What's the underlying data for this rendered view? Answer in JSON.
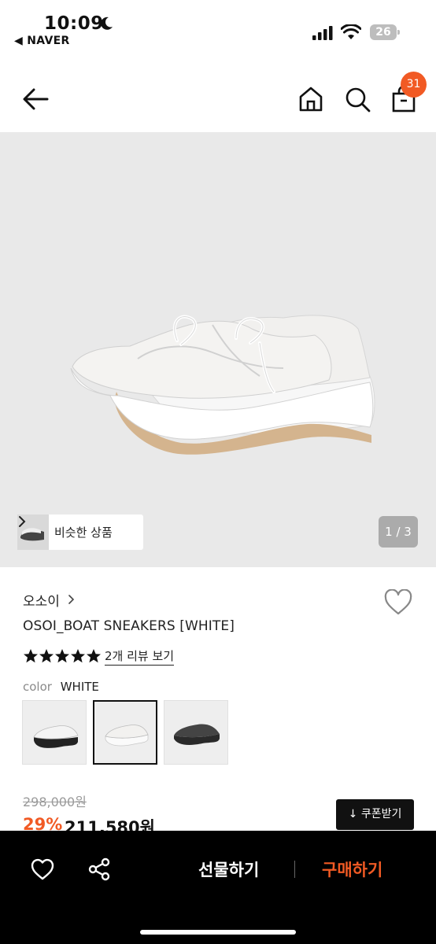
{
  "status_bar": {
    "time": "10:09",
    "back_app": "◀ NAVER",
    "battery": "26",
    "icons": [
      "moon-icon",
      "signal-icon",
      "wifi-icon",
      "battery-icon"
    ]
  },
  "nav": {
    "icons": [
      "back-arrow-icon",
      "home-icon",
      "search-icon",
      "cart-icon"
    ],
    "cart_badge": "31"
  },
  "hero": {
    "similar_label": "비슷한 상품",
    "pager": "1 / 3"
  },
  "product": {
    "brand": "오소이",
    "title": "OSOI_BOAT SNEAKERS [WHITE]",
    "rating_stars": 5,
    "review_link": "2개 리뷰 보기",
    "color_key": "color",
    "color_value": "WHITE",
    "swatches": [
      "black-white",
      "white",
      "black"
    ],
    "selected_swatch": 1,
    "original_price": "298,000원",
    "discount": "29%",
    "sale_price": "211,580원",
    "coupon_label": "↓ 쿠폰받기"
  },
  "bottom_bar": {
    "icons": [
      "heart-icon",
      "share-icon"
    ],
    "gift_label": "선물하기",
    "buy_label": "구매하기"
  },
  "colors": {
    "accent": "#f15a24",
    "black": "#000000",
    "hero_bg": "#e9e9e9"
  }
}
